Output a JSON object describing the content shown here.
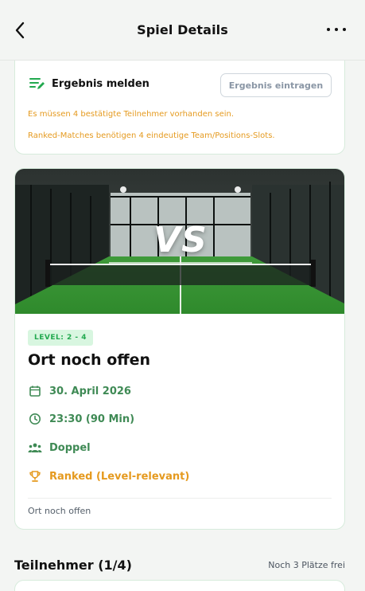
{
  "header": {
    "title": "Spiel Details",
    "back_icon": "chevron-left-icon",
    "more_icon": "more-horizontal-icon"
  },
  "result": {
    "title": "Ergebnis melden",
    "icon": "edit-list-icon",
    "button_label": "Ergebnis eintragen",
    "warnings": [
      "Es müssen 4 bestätigte Teilnehmer vorhanden sein.",
      "Ranked-Matches benötigen 4 eindeutige Team/Positions-Slots."
    ]
  },
  "match": {
    "vs_text": "VS",
    "level": "LEVEL: 2 - 4",
    "venue": "Ort noch offen",
    "date": "30. April 2026",
    "time": "23:30 (90 Min)",
    "type": "Doppel",
    "ranked": "Ranked (Level-relevant)",
    "note": "Ort noch offen"
  },
  "participants": {
    "title": "Teilnehmer (1/4)",
    "spots": "Noch 3 Plätze frei"
  },
  "colors": {
    "accent_green": "#22a94f",
    "info_green": "#3f8a55",
    "warning_orange": "#e59a1f",
    "card_border": "#d7ebdc"
  }
}
